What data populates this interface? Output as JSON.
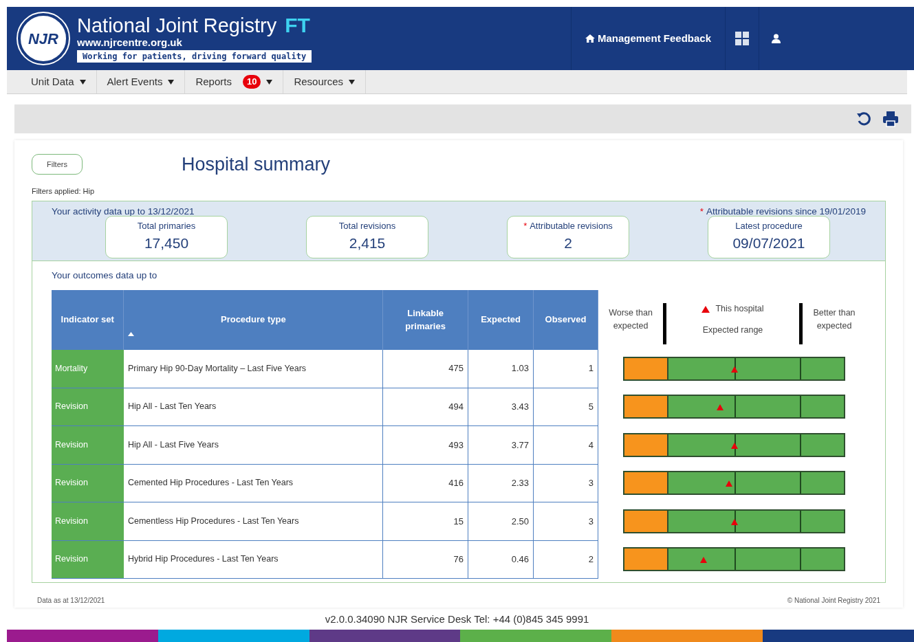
{
  "header": {
    "logo_text": "NJR",
    "title": "National Joint Registry",
    "title_suffix": "FT",
    "website": "www.njrcentre.org.uk",
    "tagline": "Working for patients, driving forward quality",
    "feedback_link": "Management Feedback"
  },
  "nav": [
    {
      "label": "Unit Data"
    },
    {
      "label": "Alert Events"
    },
    {
      "label": "Reports",
      "badge": "10"
    },
    {
      "label": "Resources"
    }
  ],
  "filters_button": "Filters",
  "page_title": "Hospital summary",
  "filters_applied": "Filters applied: Hip",
  "activity": {
    "heading": "Your activity data up to 13/12/2021",
    "footnote_mark": "*",
    "footnote": "Attributable revisions since 19/01/2019",
    "stats": [
      {
        "label": "Total primaries",
        "value": "17,450"
      },
      {
        "label": "Total revisions",
        "value": "2,415"
      },
      {
        "mark": "*",
        "label": "Attributable revisions",
        "value": "2"
      },
      {
        "label": "Latest procedure",
        "value": "09/07/2021"
      }
    ]
  },
  "outcomes": {
    "heading": "Your outcomes data up to",
    "columns": [
      "Indicator set",
      "Procedure type",
      "Linkable primaries",
      "Expected",
      "Observed"
    ],
    "legend": {
      "marker": "This hospital",
      "worse": "Worse than expected",
      "range": "Expected range",
      "better": "Better than expected"
    },
    "rows": [
      {
        "indicator": "Mortality",
        "procedure": "Primary Hip 90-Day Mortality – Last Five Years",
        "linkable": "475",
        "expected": "1.03",
        "observed": "1",
        "level": 0.5
      },
      {
        "indicator": "Revision",
        "procedure": "Hip All - Last Ten Years",
        "linkable": "494",
        "expected": "3.43",
        "observed": "5",
        "level": 0.437
      },
      {
        "indicator": "Revision",
        "procedure": "Hip All - Last Five Years",
        "linkable": "493",
        "expected": "3.77",
        "observed": "4",
        "level": 0.5
      },
      {
        "indicator": "Revision",
        "procedure": "Cemented Hip Procedures - Last Ten Years",
        "linkable": "416",
        "expected": "2.33",
        "observed": "3",
        "level": 0.477
      },
      {
        "indicator": "Revision",
        "procedure": "Cementless Hip Procedures - Last Ten Years",
        "linkable": "15",
        "expected": "2.50",
        "observed": "3",
        "level": 0.5
      },
      {
        "indicator": "Revision",
        "procedure": "Hybrid Hip Procedures - Last Ten Years",
        "linkable": "76",
        "expected": "0.46",
        "observed": "2",
        "level": 0.36
      }
    ]
  },
  "data_as_at": "Data as at 13/12/2021",
  "copyright": "© National Joint Registry 2021",
  "version_line": "v2.0.0.34090 NJR Service Desk Tel: +44 (0)845 345 9991"
}
